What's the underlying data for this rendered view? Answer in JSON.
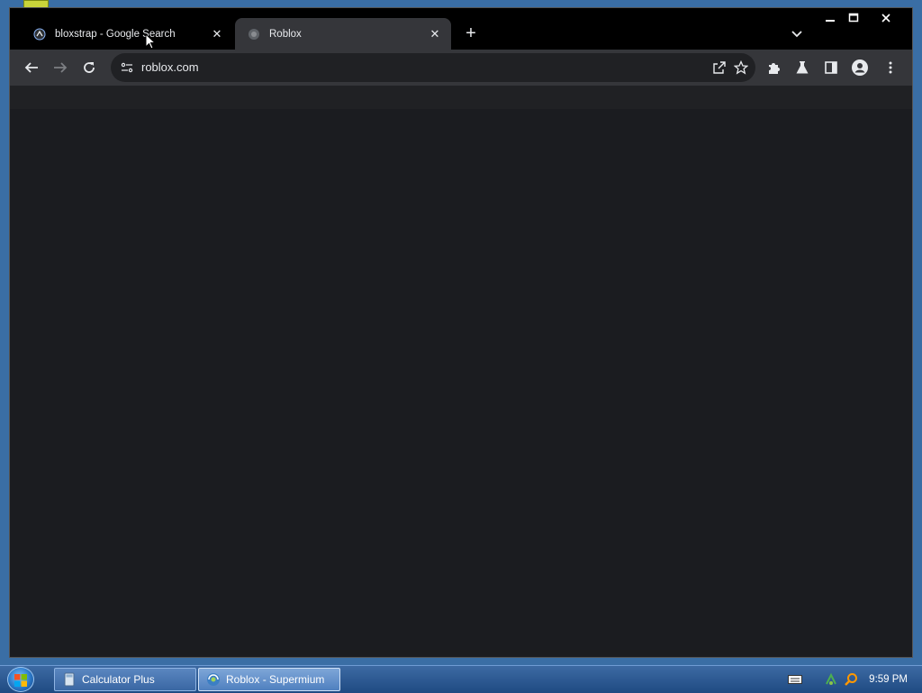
{
  "browser": {
    "tabs": [
      {
        "title": "bloxstrap - Google Search",
        "active": false
      },
      {
        "title": "Roblox",
        "active": true
      }
    ],
    "address_bar": {
      "url": "roblox.com"
    }
  },
  "taskbar": {
    "items": [
      {
        "label": "Calculator Plus",
        "active": false
      },
      {
        "label": "Roblox - Supermium",
        "active": true
      }
    ],
    "clock": "9:59 PM"
  },
  "icons": {
    "back": "arrow-left-icon",
    "forward": "arrow-right-icon",
    "reload": "reload-icon",
    "share": "share-icon",
    "bookmark": "star-icon",
    "extensions": "puzzle-icon",
    "labs": "flask-icon",
    "side_panel": "side-panel-icon",
    "profile": "profile-icon",
    "menu": "more-vert-icon"
  },
  "colors": {
    "tab_active": "#35363a",
    "toolbar": "#35363a",
    "page_background": "#1b1c20",
    "taskbar": "#2a5a96"
  }
}
